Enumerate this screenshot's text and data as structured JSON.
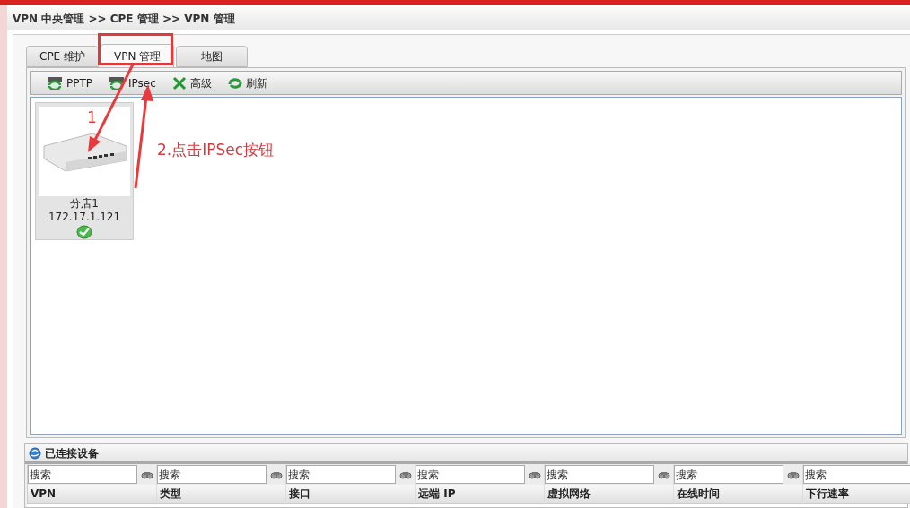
{
  "breadcrumb": "VPN 中央管理 >> CPE 管理 >> VPN 管理",
  "tabs": [
    {
      "label": "CPE 维护",
      "selected": false
    },
    {
      "label": "VPN 管理",
      "selected": true
    },
    {
      "label": "地图",
      "selected": false
    }
  ],
  "toolbar": [
    {
      "label": "PPTP",
      "kind": "pptp"
    },
    {
      "label": "IPsec",
      "kind": "ipsec"
    },
    {
      "label": "高级",
      "kind": "tools"
    },
    {
      "label": "刷新",
      "kind": "refresh"
    }
  ],
  "devices": [
    {
      "name": "分店1",
      "ip": "172.17.1.121",
      "online": true
    }
  ],
  "annotations": {
    "step_1": "1",
    "step_2": "2.点击IPSec按钮"
  },
  "connected": {
    "title": "已连接设备",
    "columns": [
      {
        "placeholder": "搜索",
        "heading": "VPN"
      },
      {
        "placeholder": "搜索",
        "heading": "类型"
      },
      {
        "placeholder": "搜索",
        "heading": "接口"
      },
      {
        "placeholder": "搜索",
        "heading": "远端 IP"
      },
      {
        "placeholder": "搜索",
        "heading": "虚拟网络"
      },
      {
        "placeholder": "搜索",
        "heading": "在线时间"
      },
      {
        "placeholder": "搜索",
        "heading": "下行速率"
      }
    ]
  }
}
